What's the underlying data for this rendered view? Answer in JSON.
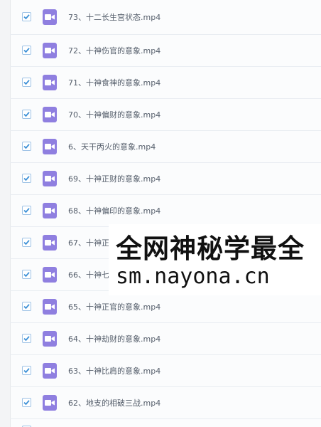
{
  "files": [
    {
      "name": "73、十二长生宫状态.mp4",
      "checked": true,
      "icon": "video-icon"
    },
    {
      "name": "72、十神伤官的意象.mp4",
      "checked": true,
      "icon": "video-icon"
    },
    {
      "name": "71、十神食神的意象.mp4",
      "checked": true,
      "icon": "video-icon"
    },
    {
      "name": "70、十神偏财的意象.mp4",
      "checked": true,
      "icon": "video-icon"
    },
    {
      "name": "6、天干丙火的意象.mp4",
      "checked": true,
      "icon": "video-icon"
    },
    {
      "name": "69、十神正财的意象.mp4",
      "checked": true,
      "icon": "video-icon"
    },
    {
      "name": "68、十神偏印的意象.mp4",
      "checked": true,
      "icon": "video-icon"
    },
    {
      "name": "67、十神正",
      "checked": true,
      "icon": "video-icon"
    },
    {
      "name": "66、十神七",
      "checked": true,
      "icon": "video-icon"
    },
    {
      "name": "65、十神正官的意象.mp4",
      "checked": true,
      "icon": "video-icon"
    },
    {
      "name": "64、十神劫财的意象.mp4",
      "checked": true,
      "icon": "video-icon"
    },
    {
      "name": "63、十神比肩的意象.mp4",
      "checked": true,
      "icon": "video-icon"
    },
    {
      "name": "62、地支的相破三战.mp4",
      "checked": true,
      "icon": "video-icon"
    }
  ],
  "watermark": {
    "line1": "全网神秘学最全",
    "line2": "sm.nayona.cn"
  },
  "colors": {
    "icon_bg": "#8f7fe0",
    "check": "#3a8fd6",
    "text": "#555e6b"
  }
}
